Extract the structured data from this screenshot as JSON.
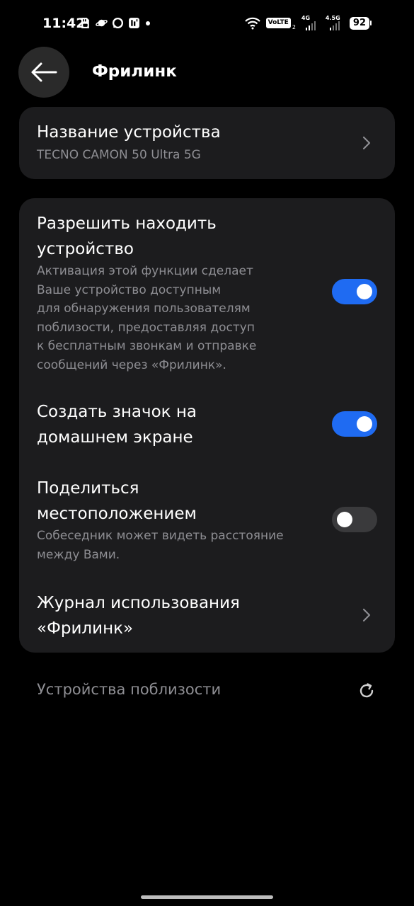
{
  "status_bar": {
    "time": "11:42",
    "volte": "VoLTE",
    "volte_sim": "2",
    "net1": "4G",
    "net2": "4.5G",
    "battery": "92"
  },
  "header": {
    "title": "Фрилинк"
  },
  "device_card": {
    "title": "Название устройства",
    "value": "TECNO CAMON 50 Ultra 5G"
  },
  "settings": {
    "discover": {
      "title_line1": "Разрешить находить",
      "title_line2": "устройство",
      "desc_lines": [
        "Активация этой функции сделает",
        "Ваше устройство доступным",
        "для обнаружения пользователям",
        "поблизости, предоставляя доступ",
        "к бесплатным звонкам и отправке",
        "сообщений через «Фрилинк»."
      ],
      "enabled": true
    },
    "shortcut": {
      "title_line1": "Создать значок на",
      "title_line2": "домашнем экране",
      "enabled": true
    },
    "location": {
      "title_line1": "Поделиться",
      "title_line2": "местоположением",
      "desc_lines": [
        "Собеседник может видеть расстояние",
        "между Вами."
      ],
      "enabled": false
    },
    "usage_log": {
      "title_line1": "Журнал использования",
      "title_line2": "«Фрилинк»"
    }
  },
  "nearby": {
    "label": "Устройства поблизости"
  },
  "colors": {
    "background": "#000000",
    "card": "#1c1c1e",
    "accent": "#1f6bf2",
    "secondary_text": "#8e8e93"
  }
}
